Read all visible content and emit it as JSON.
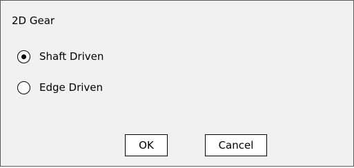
{
  "dialog": {
    "title": "2D Gear",
    "options": [
      {
        "label": "Shaft Driven",
        "selected": true
      },
      {
        "label": "Edge Driven",
        "selected": false
      }
    ],
    "ok_label": "OK",
    "cancel_label": "Cancel"
  },
  "colors": {
    "dialog_background": "#f1f1f1",
    "border": "#5a5a5a",
    "button_background": "#ffffff",
    "text": "#000000"
  },
  "icons": {
    "selected_radio": "radio-selected-icon",
    "unselected_radio": "radio-unselected-icon"
  }
}
